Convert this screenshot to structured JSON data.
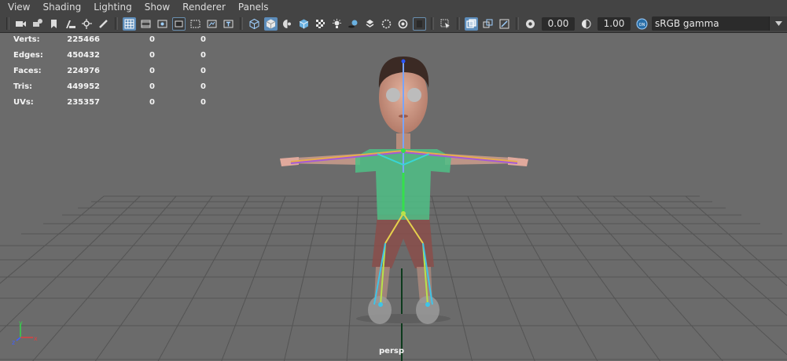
{
  "menu": {
    "items": [
      "View",
      "Shading",
      "Lighting",
      "Show",
      "Renderer",
      "Panels"
    ]
  },
  "toolbar": {
    "exposure_value": "0.00",
    "gamma_value": "1.00",
    "color_space": "sRGB gamma",
    "icons": [
      "camera-icon",
      "camera-attributes-icon",
      "bookmark-icon",
      "image-plane-icon",
      "two-d-pan-zoom-icon",
      "grease-pencil-icon",
      "grid-icon",
      "film-gate-icon",
      "resolution-gate-icon",
      "gate-mask-icon",
      "field-chart-icon",
      "safe-action-icon",
      "safe-title-icon",
      "wireframe-icon",
      "smooth-shade-icon",
      "use-default-material-icon",
      "wireframe-on-shaded-icon",
      "textured-icon",
      "use-all-lights-icon",
      "shadows-icon",
      "screen-space-ao-icon",
      "motion-blur-icon",
      "multisample-aa-icon",
      "depth-of-field-icon",
      "isolate-select-icon",
      "xray-icon",
      "xray-active-components-icon",
      "xray-joints-icon",
      "exposure-icon",
      "gamma-icon",
      "color-management-icon"
    ]
  },
  "hud": {
    "rows": [
      {
        "label": "Verts:",
        "v1": "225466",
        "v2": "0",
        "v3": "0"
      },
      {
        "label": "Edges:",
        "v1": "450432",
        "v2": "0",
        "v3": "0"
      },
      {
        "label": "Faces:",
        "v1": "224976",
        "v2": "0",
        "v3": "0"
      },
      {
        "label": "Tris:",
        "v1": "449952",
        "v2": "0",
        "v3": "0"
      },
      {
        "label": "UVs:",
        "v1": "235357",
        "v2": "0",
        "v3": "0"
      }
    ]
  },
  "viewport": {
    "camera_name": "persp",
    "axis_labels": {
      "x": "x",
      "y": "y",
      "z": "z"
    }
  },
  "colors": {
    "menubar_bg": "#444444",
    "viewport_bg": "#6b6b6b",
    "grid_line": "#555555",
    "active_tool": "#5d8dbb",
    "shirt": "#4fbf86",
    "shorts": "#8a4d4a",
    "skin": "#d29b86"
  }
}
